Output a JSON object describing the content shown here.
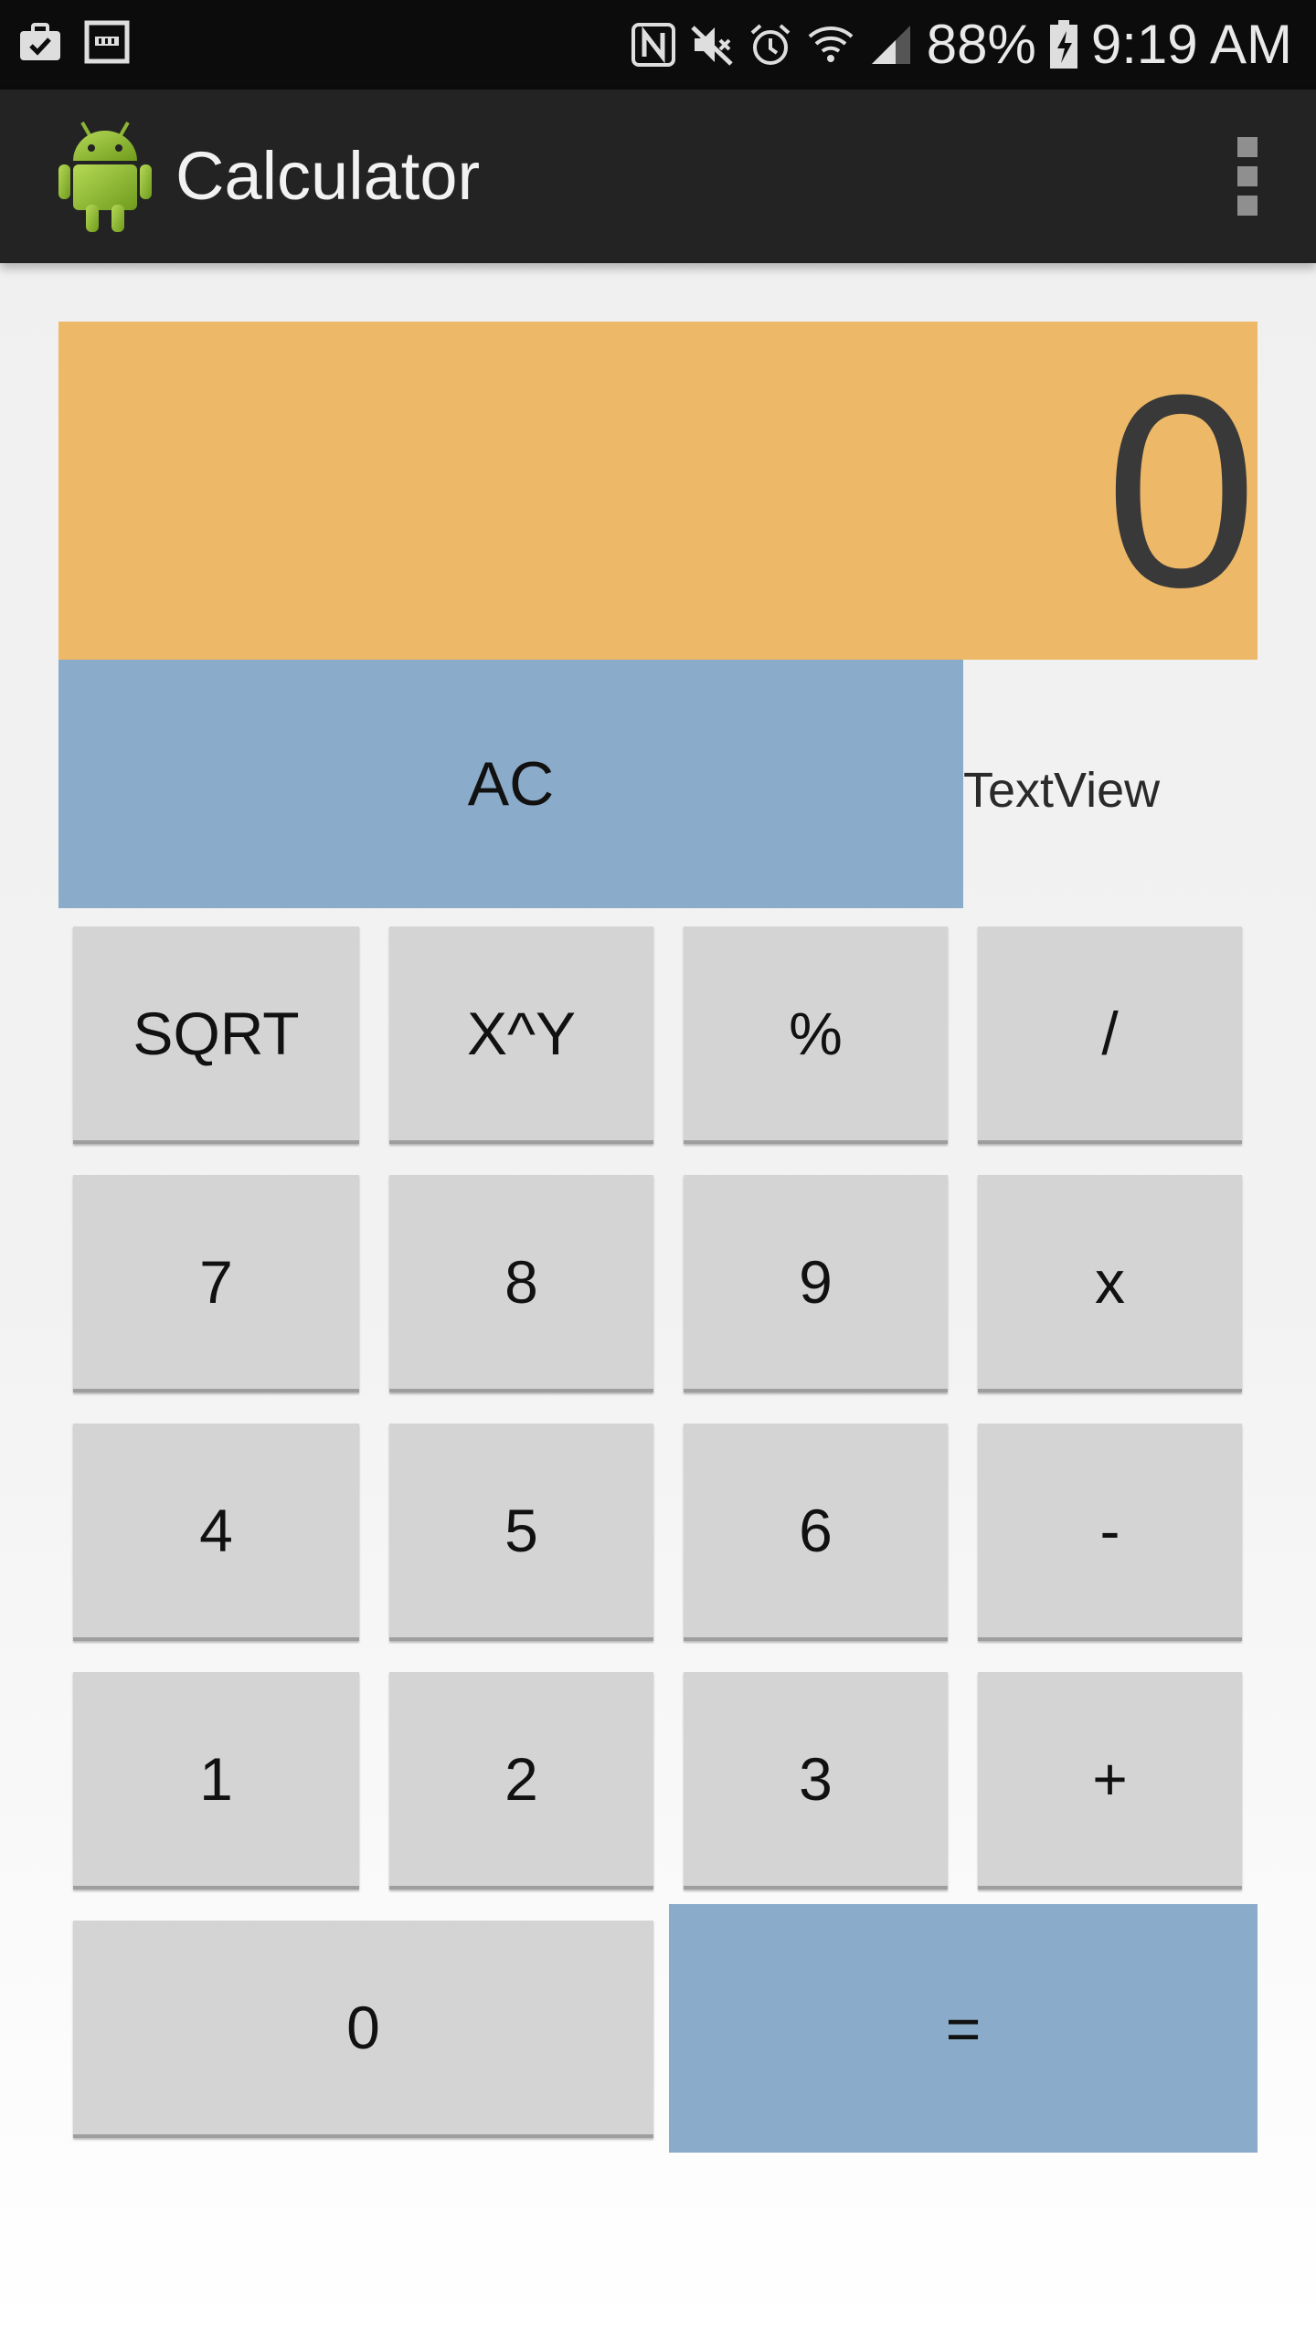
{
  "status_bar": {
    "battery": "88%",
    "time": "9:19 AM",
    "left_icons": [
      "briefcase-icon",
      "tablet-icon"
    ],
    "right_icons": [
      "nfc-icon",
      "mute-icon",
      "alarm-icon",
      "wifi-icon",
      "signal-icon",
      "battery-charging-icon"
    ]
  },
  "app_bar": {
    "title": "Calculator",
    "logo_icon": "android-robot-icon",
    "menu_icon": "overflow-menu-icon"
  },
  "display": {
    "value": "0"
  },
  "controls": {
    "clear_label": "AC",
    "textview_label": "TextView"
  },
  "keys": {
    "row1": [
      "SQRT",
      "X^Y",
      "%",
      "/"
    ],
    "row2": [
      "7",
      "8",
      "9",
      "x"
    ],
    "row3": [
      "4",
      "5",
      "6",
      "-"
    ],
    "row4": [
      "1",
      "2",
      "3",
      "+"
    ],
    "row5": [
      "0",
      "="
    ]
  },
  "colors": {
    "display_bg": "#edb968",
    "accent_blue": "#8aabc9",
    "key_bg": "#d4d4d4",
    "app_bar_bg": "#232323",
    "status_bar_bg": "#0c0c0c"
  }
}
